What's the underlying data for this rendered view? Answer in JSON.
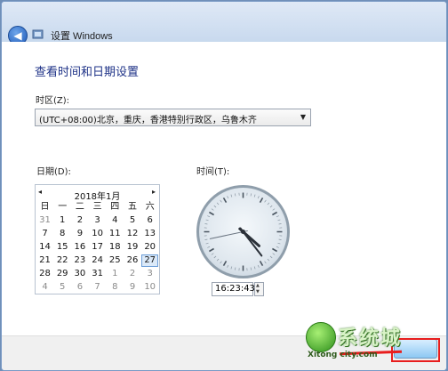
{
  "window": {
    "title": "设置 Windows"
  },
  "icons": {
    "back": "back-arrow-icon",
    "app": "windows-setup-icon"
  },
  "main": {
    "heading": "查看时间和日期设置",
    "timezone_label": "时区(Z):",
    "timezone_value": "(UTC+08:00)北京，重庆，香港特别行政区，乌鲁木齐",
    "date_label": "日期(D):",
    "time_label": "时间(T):"
  },
  "calendar": {
    "month_title": "2018年1月",
    "prev": "◂",
    "next": "▸",
    "weekdays": [
      "日",
      "一",
      "二",
      "三",
      "四",
      "五",
      "六"
    ],
    "weeks": [
      [
        "31",
        "1",
        "2",
        "3",
        "4",
        "5",
        "6"
      ],
      [
        "7",
        "8",
        "9",
        "10",
        "11",
        "12",
        "13"
      ],
      [
        "14",
        "15",
        "16",
        "17",
        "18",
        "19",
        "20"
      ],
      [
        "21",
        "22",
        "23",
        "24",
        "25",
        "26",
        "27"
      ],
      [
        "28",
        "29",
        "30",
        "31",
        "1",
        "2",
        "3"
      ],
      [
        "4",
        "5",
        "6",
        "7",
        "8",
        "9",
        "10"
      ]
    ],
    "selected": "27"
  },
  "clock": {
    "hour": 16,
    "minute": 23,
    "second": 43
  },
  "time_input": {
    "value": "16:23:43"
  },
  "footer": {
    "logo_text": "系统城",
    "logo_sub": "Xitong city.com"
  },
  "colors": {
    "heading": "#1e3287",
    "annotation": "#e81d1d"
  }
}
